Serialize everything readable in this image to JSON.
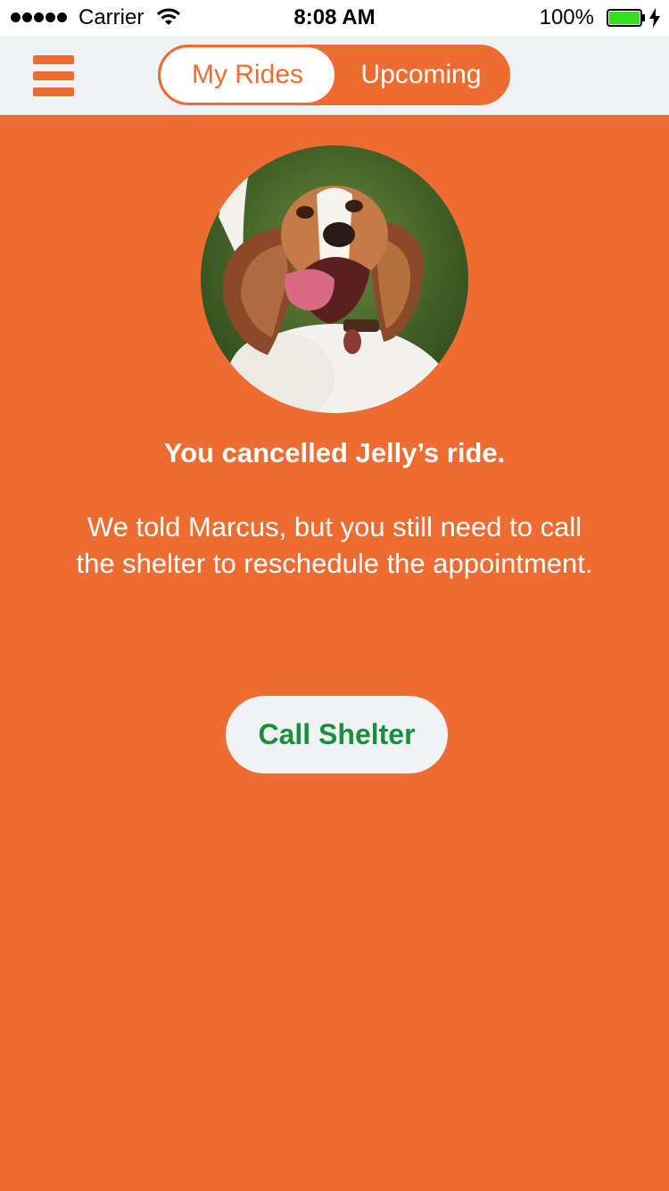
{
  "status_bar": {
    "carrier": "Carrier",
    "time": "8:08 AM",
    "battery": "100%",
    "battery_color": "#33E01F"
  },
  "nav": {
    "menu_icon": "hamburger-menu-icon",
    "tabs": [
      {
        "label": "My Rides",
        "selected": true
      },
      {
        "label": "Upcoming",
        "selected": false
      }
    ]
  },
  "main": {
    "avatar": "dog-photo",
    "headline": "You cancelled Jelly’s ride.",
    "message": "We told Marcus, but you still need to call the shelter to reschedule the appointment.",
    "call_button": "Call Shelter"
  },
  "colors": {
    "accent": "#EE6C32",
    "nav_background": "#F1F2F4",
    "button_text": "#178F3C"
  }
}
